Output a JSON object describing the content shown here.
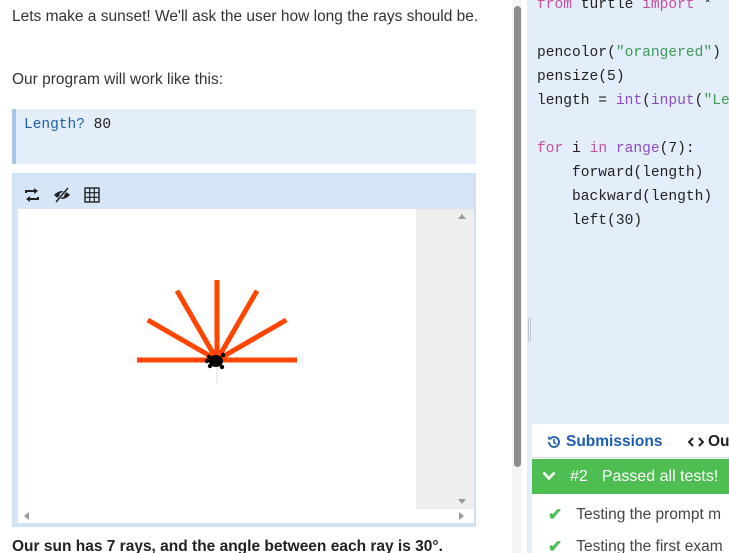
{
  "instructions": {
    "intro": "Lets make a sunset! We'll ask the user how long the rays should be.",
    "program_works": "Our program will work like this:",
    "example_prompt": "Length? ",
    "example_answer": "80",
    "sun_note": "Our sun has 7 rays, and the angle between each ray is 30°."
  },
  "turtle_panel": {
    "toolbar_icons": [
      "repeat-icon",
      "eye-slash-icon",
      "grid-icon"
    ],
    "rays": 7,
    "ray_angle_deg": 30,
    "ray_length": 80,
    "pen_color": "#ff4500",
    "pen_size": 5
  },
  "code_editor": {
    "lines": [
      [
        {
          "t": "from ",
          "c": "kw"
        },
        {
          "t": "turtle ",
          "c": ""
        },
        {
          "t": "import",
          "c": "kw"
        },
        {
          "t": " *",
          "c": ""
        }
      ],
      [],
      [
        {
          "t": "pencolor",
          "c": ""
        },
        {
          "t": "(",
          "c": ""
        },
        {
          "t": "\"orangered\"",
          "c": "str"
        },
        {
          "t": ")",
          "c": ""
        }
      ],
      [
        {
          "t": "pensize(5)",
          "c": ""
        }
      ],
      [
        {
          "t": "length = ",
          "c": ""
        },
        {
          "t": "int",
          "c": "fn"
        },
        {
          "t": "(",
          "c": ""
        },
        {
          "t": "input",
          "c": "fn"
        },
        {
          "t": "(",
          "c": ""
        },
        {
          "t": "\"Le",
          "c": "str"
        }
      ],
      [],
      [
        {
          "t": "for",
          "c": "kw"
        },
        {
          "t": " i ",
          "c": ""
        },
        {
          "t": "in",
          "c": "kw"
        },
        {
          "t": " ",
          "c": ""
        },
        {
          "t": "range",
          "c": "fn"
        },
        {
          "t": "(7):",
          "c": ""
        }
      ],
      [
        {
          "t": "    forward(length)",
          "c": ""
        }
      ],
      [
        {
          "t": "    backward(length)",
          "c": ""
        }
      ],
      [
        {
          "t": "    left(30)",
          "c": ""
        }
      ]
    ]
  },
  "results": {
    "tab_submissions": "Submissions",
    "tab_output": "Out",
    "submission_number": "#2",
    "status": "Passed all tests!",
    "tests": [
      "Testing the prompt m",
      "Testing the first exam"
    ],
    "colors": {
      "pass": "#4fbe52",
      "tab_active": "#1a5fae"
    }
  }
}
